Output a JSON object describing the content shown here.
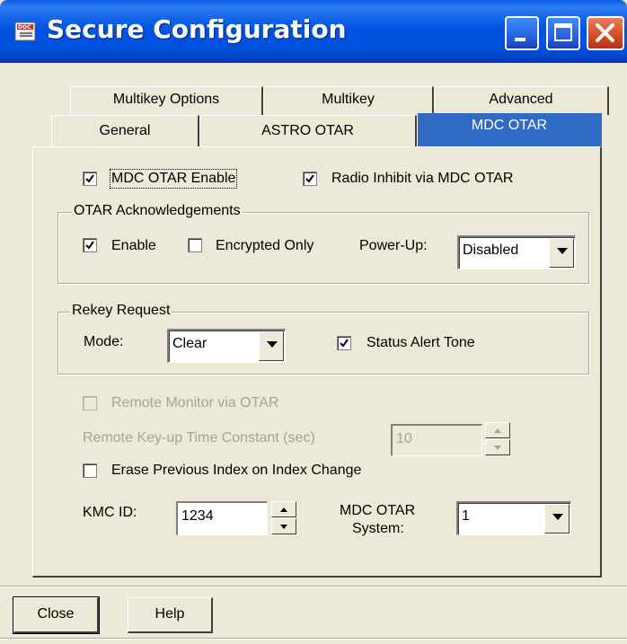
{
  "window": {
    "title": "Secure Configuration"
  },
  "tabs_row1": [
    {
      "label": "Multikey Options"
    },
    {
      "label": "Multikey"
    },
    {
      "label": "Advanced"
    }
  ],
  "tabs_row2": [
    {
      "label": "General"
    },
    {
      "label": "ASTRO OTAR"
    },
    {
      "label": "MDC OTAR",
      "selected": true
    }
  ],
  "mdc_otar_enable": {
    "label": "MDC OTAR Enable",
    "checked": true
  },
  "radio_inhibit": {
    "label": "Radio Inhibit via MDC OTAR",
    "checked": true
  },
  "ack_group": {
    "title": "OTAR Acknowledgements",
    "enable": {
      "label": "Enable",
      "checked": true
    },
    "encrypted_only": {
      "label": "Encrypted Only",
      "checked": false
    },
    "powerup_label": "Power-Up:",
    "powerup_value": "Disabled"
  },
  "rekey_group": {
    "title": "Rekey Request",
    "mode_label": "Mode:",
    "mode_value": "Clear",
    "status_alert": {
      "label": "Status Alert Tone",
      "checked": true
    }
  },
  "remote_monitor": {
    "label": "Remote Monitor via OTAR",
    "checked": false,
    "enabled": false
  },
  "remote_keyup": {
    "label": "Remote Key-up Time Constant (sec)",
    "value": "10",
    "enabled": false
  },
  "erase_previous": {
    "label": "Erase Previous Index on Index Change",
    "checked": false
  },
  "kmc_id": {
    "label": "KMC ID:",
    "value": "1234"
  },
  "mdc_otar_system": {
    "label_line1": "MDC OTAR",
    "label_line2": "System:",
    "value": "1"
  },
  "buttons": {
    "close": "Close",
    "help": "Help"
  },
  "colors": {
    "titlebar": "#0054E3",
    "selected_tab": "#316AC5",
    "dialog_bg": "#ECE9D8"
  }
}
